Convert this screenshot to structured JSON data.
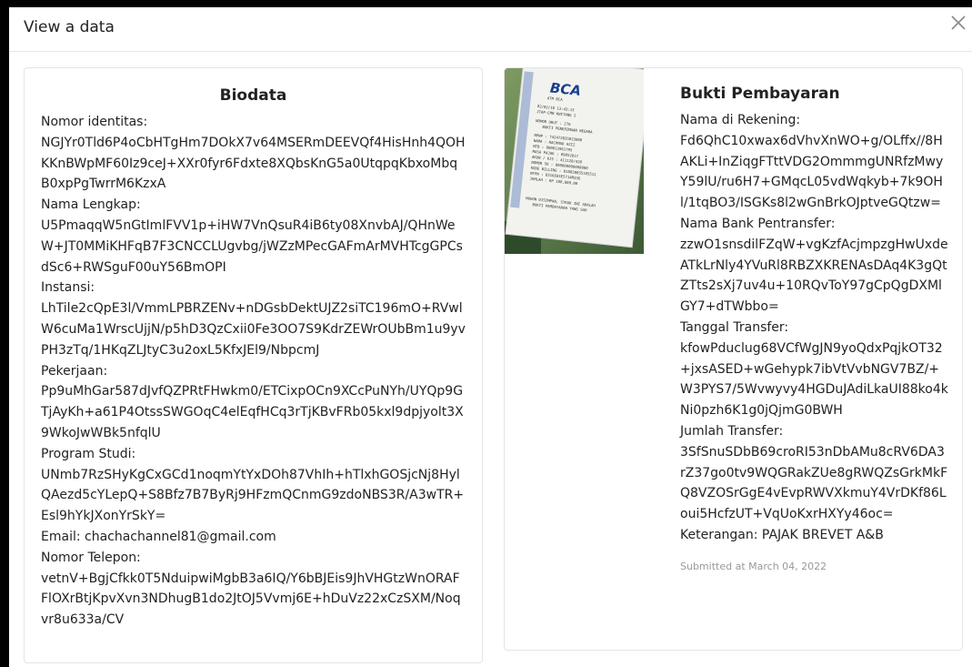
{
  "modal": {
    "title": "View a data",
    "close_icon": "close-icon"
  },
  "biodata": {
    "title": "Biodata",
    "nomor_identitas_label": "Nomor identitas:",
    "nomor_identitas_value": "NGJYr0Tld6P4oCbHTgHm7DOkX7v64MSERmDEEVQf4HisHnh4QOHKKnBWpMF60Iz9ceJ+XXr0fyr6Fdxte8XQbsKnG5a0UtqpqKbxoMbqB0xpPgTwrrM6KzxA",
    "nama_lengkap_label": "Nama Lengkap:",
    "nama_lengkap_value": "U5PmaqqW5nGtImlFVV1p+iHW7VnQsuR4iB6ty08XnvbAJ/QHnWeW+JT0MMiKHFqB7F3CNCCLUgvbg/jWZzMPecGAFmArMVHTcgGPCsdSc6+RWSguF00uY56BmOPI",
    "instansi_label": "Instansi:",
    "instansi_value": "LhTile2cQpE3l/VmmLPBRZENv+nDGsbDektUJZ2siTC196mO+RVwlW6cuMa1WrscUjjN/p5hD3QzCxii0Fe3OO7S9KdrZEWrOUbBm1u9yvPH3zTq/1HKqZLJtyC3u2oxL5KfxJEl9/NbpcmJ",
    "pekerjaan_label": "Pekerjaan:",
    "pekerjaan_value": "Pp9uMhGar587dJvfQZPRtFHwkm0/ETCixpOCn9XCcPuNYh/UYQp9GTjAyKh+a61P4OtssSWGOqC4elEqfHCq3rTjKBvFRb05kxl9dpjyolt3X9WkoJwWBk5nfqlU",
    "program_studi_label": "Program Studi:",
    "program_studi_value": "UNmb7RzSHyKgCxGCd1noqmYtYxDOh87VhIh+hTlxhGOSjcNj8HylQAezd5cYLepQ+S8Bfz7B7ByRj9HFzmQCnmG9zdoNBS3R/A3wTR+Esl9hYkJXonYrSkY=",
    "email_line": "Email: chachachannel81@gmail.com",
    "nomor_telepon_label": "Nomor Telepon:",
    "nomor_telepon_value": "vetnV+BgjCfkk0T5NduipwiMgbB3a6IQ/Y6bBJEis9JhVHGtzWnORAFFlOXrBtjKpvXvn3NDhugB1do2JtOJ5Vvmj6E+hDuVz22xCzSXM/Noqvr8u633a/CV"
  },
  "bukti": {
    "title": "Bukti Pembayaran",
    "nama_rekening_label": "Nama di Rekening:",
    "nama_rekening_value": "Fd6QhC10xwax6dVhvXnWO+g/OLffx//8HAKLi+InZiqgFTttVDG2OmmmgUNRfzMwyY59lU/ru6H7+GMqcL05vdWqkyb+7k9OHl/1tqBO3/ISGKs8l2wGnBrkOJptveGQtzw=",
    "nama_bank_label": "Nama Bank Pentransfer:",
    "nama_bank_value": "zzwO1snsdilFZqW+vgKzfAcjmpzgHwUxdeATkLrNly4YVuRl8RBZXKRENAsDAq4K3gQtZTts2sXj7uv4u+10RQvToY97gCpQgDXMlGY7+dTWbbo=",
    "tanggal_label": "Tanggal Transfer:",
    "tanggal_value": "kfowPduclug68VCfWgJN9yoQdxPqjkOT32+jxsASED+wGehypk7ibVtVvbNGV7BZ/+W3PYS7/5Wvwyvy4HGDuJAdiLkaUI88ko4kNi0pzh6K1g0jQjmG0BWH",
    "jumlah_label": "Jumlah Transfer:",
    "jumlah_value": "3SfSnuSDbB69croRI53nDbAMu8cRV6DA3rZ37go0tv9WQGRakZUe8gRWQZsGrkMkFQ8VZOSrGgE4vEvpRWVXkmuY4VrDKf86Loui5HcfzUT+VqUoKxrHXYy46oc=",
    "keterangan_line": "Keterangan: PAJAK BREVET A&B",
    "submitted": "Submitted at March 04, 2022"
  },
  "receipt": {
    "bank": "BCA",
    "atm": "ATM BCA",
    "date": "02/02/18   13:43:13",
    "place": "JTAP-CMN KWITANG 2",
    "urut": "NOMOR URUT  : 276",
    "jenis": "BUKTI PENERIMAAN NEGARA",
    "npwp": "NPWP     : 742472835023000",
    "nama": "NAMA     : RACHMAD AZIZ",
    "ntb": "NTB      : 000012961795",
    "masa": "MASA PAJAK : 09052017",
    "akun": "AKUN / KJS : 411128/420",
    "nomor_sk": "NOMOR SK  : 000000000000000",
    "kode": "KODE BILLING : 018020035105511",
    "ntpn": "NTPN     : 8316E65E5714M336",
    "jumlah": "JUMLAH   : RP       100,000.00",
    "footer1": "MOHON DISIMPAN, STRUK INI ADALAH",
    "footer2": "BUKTI PEMBAYARAN YANG SAH"
  }
}
